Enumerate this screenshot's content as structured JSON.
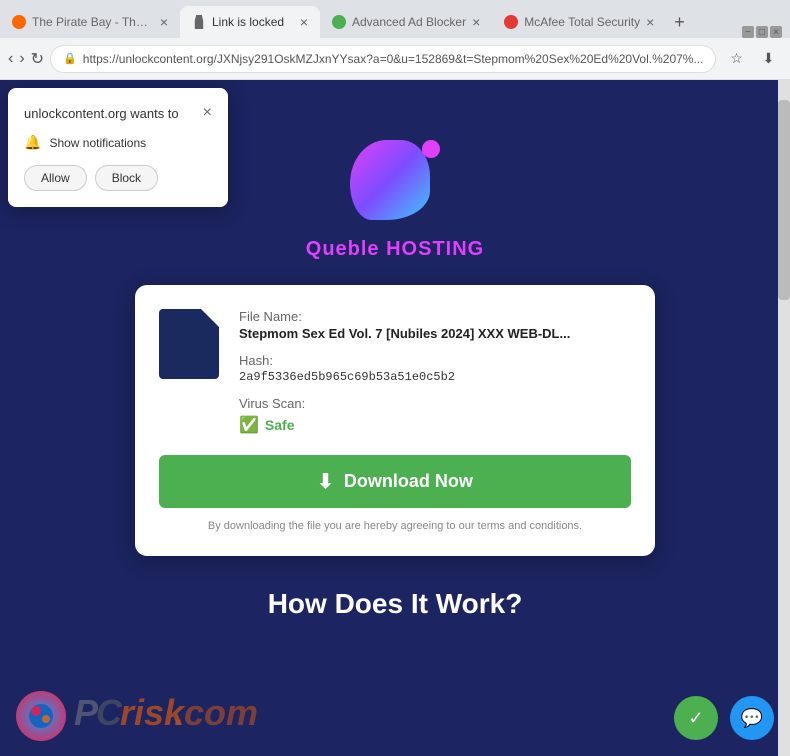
{
  "browser": {
    "tabs": [
      {
        "id": "tab1",
        "label": "The Pirate Bay - The g...",
        "favicon": "pirate",
        "active": false
      },
      {
        "id": "tab2",
        "label": "Link is locked",
        "favicon": "lock",
        "active": true
      },
      {
        "id": "tab3",
        "label": "Advanced Ad Blocker",
        "favicon": "green",
        "active": false
      },
      {
        "id": "tab4",
        "label": "McAfee Total Security",
        "favicon": "red",
        "active": false
      }
    ],
    "address": "https://unlockcontent.org/JXNjsy291OskMZJxnYYsax?a=0&u=152869&t=Stepmom%20Sex%20Ed%20Vol.%207%...",
    "address_short": "https://unlockcontent.org/JXNjsy291OskMZJxnYYsax?a=0&u=152869&t=Stepmom%20Sex%20Ed%20Vol.%207%..."
  },
  "notification": {
    "title": "unlockcontent.org wants to",
    "subtitle": "Show notifications",
    "allow_label": "Allow",
    "block_label": "Block"
  },
  "page": {
    "logo_text": "Queble HOSTING",
    "file": {
      "name_label": "File Name:",
      "name_value": "Stepmom Sex Ed Vol. 7 [Nubiles 2024] XXX WEB-DL...",
      "hash_label": "Hash:",
      "hash_value": "2a9f5336ed5b965c69b53a51e0c5b2",
      "virus_label": "Virus Scan:",
      "virus_status": "Safe"
    },
    "download_btn": "Download Now",
    "terms": "By downloading the file you are hereby agreeing to our terms and conditions.",
    "how_title": "How Does It Work?"
  }
}
